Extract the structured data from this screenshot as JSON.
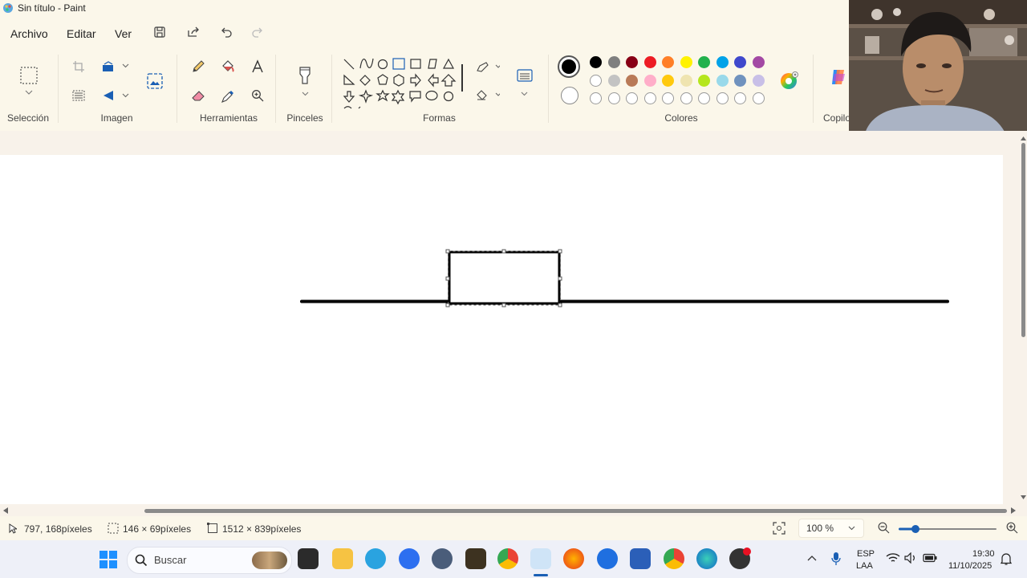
{
  "window": {
    "title": "Sin título - Paint"
  },
  "menu": {
    "archivo": "Archivo",
    "editar": "Editar",
    "ver": "Ver"
  },
  "ribbon": {
    "groups": {
      "seleccion": "Selección",
      "imagen": "Imagen",
      "herramientas": "Herramientas",
      "pinceles": "Pinceles",
      "formas": "Formas",
      "colores": "Colores",
      "copilot": "Copilo"
    },
    "colors": {
      "primary": "#000000",
      "secondary": "#ffffff",
      "row1": [
        "#000000",
        "#7f7f7f",
        "#880015",
        "#ed1c24",
        "#ff7f27",
        "#fff200",
        "#22b14c",
        "#00a2e8",
        "#3f48cc",
        "#a349a4"
      ],
      "row2": [
        "#ffffff",
        "#c3c3c3",
        "#b97a57",
        "#ffaec9",
        "#ffc90e",
        "#efe4b0",
        "#b5e61d",
        "#99d9ea",
        "#7092be",
        "#c8bfe7"
      ]
    }
  },
  "status": {
    "cursor_pos": "797, 168píxeles",
    "selection_size": "146 × 69píxeles",
    "canvas_size": "1512 × 839píxeles",
    "zoom": "100 %"
  },
  "taskbar": {
    "search_placeholder": "Buscar",
    "language": "ESP",
    "language_sub": "LAA",
    "time": "19:30",
    "date": "11/10/2025"
  }
}
